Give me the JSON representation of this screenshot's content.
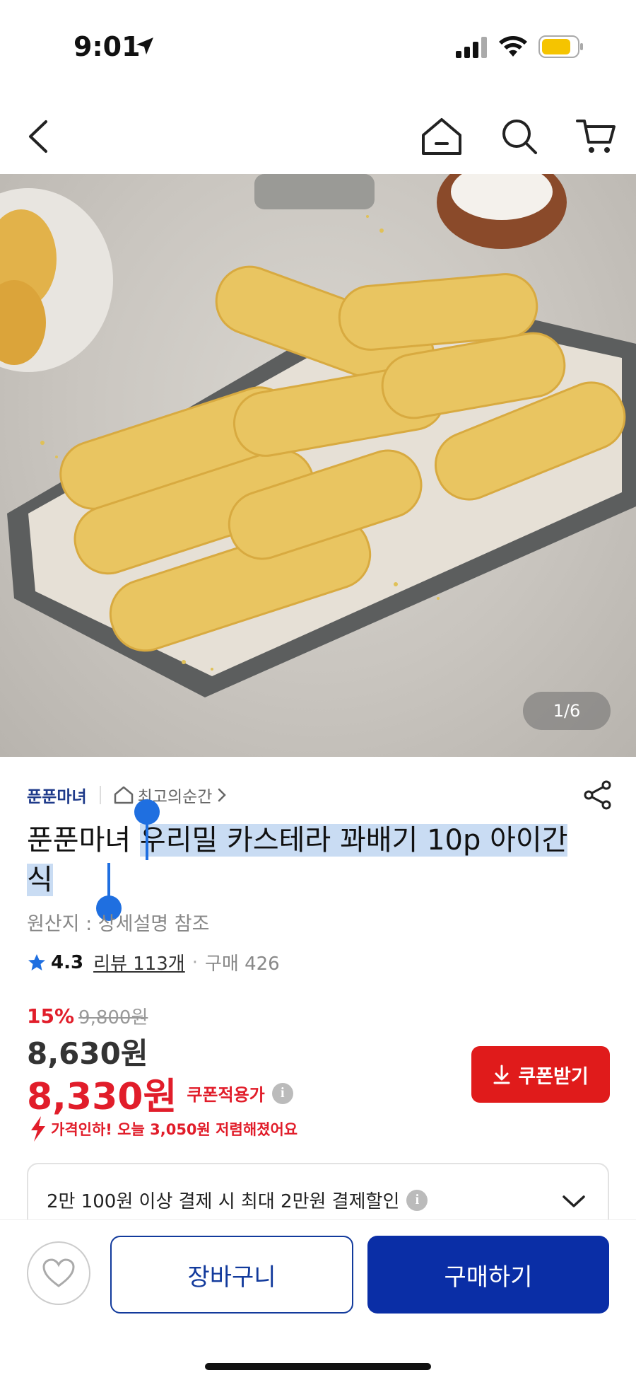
{
  "status_bar": {
    "time": "9:01"
  },
  "image": {
    "counter": "1/6"
  },
  "product": {
    "brand": "푼푼마녀",
    "store": "최고의순간",
    "title_brand": "푼푼마녀",
    "title_selected": "우리밀 카스테라 꽈배기 10p 아이간식",
    "origin": "원산지 : 상세설명 참조",
    "rating": "4.3",
    "reviews": "리뷰 113개",
    "purchases": "구매 426"
  },
  "price": {
    "discount_rate": "15%",
    "original_price": "9,800원",
    "sale_price": "8,630원",
    "coupon_price": "8,330원",
    "coupon_applicable": "쿠폰적용가",
    "coupon_button": "쿠폰받기",
    "price_drop": "가격인하! 오늘 3,050원 저렴해졌어요"
  },
  "benefit": {
    "text": "2만 100원 이상 결제 시 최대 2만원 결제할인"
  },
  "actions": {
    "cart": "장바구니",
    "buy": "구매하기"
  },
  "colors": {
    "brand_blue": "#0a2ea6",
    "sale_red": "#e11d2a",
    "selection": "#c9dcf3"
  }
}
